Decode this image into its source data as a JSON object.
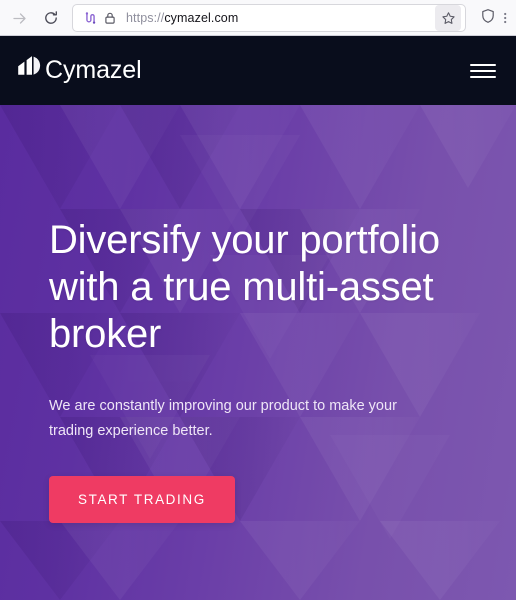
{
  "browser": {
    "forward_label": "forward-arrow",
    "reload_label": "reload",
    "extension_icon_label": "extension-icon",
    "lock_label": "connection-secure-lock",
    "url_scheme": "https://",
    "url_host": "cymazel.com",
    "url_full": "https://cymazel.com",
    "bookmark_label": "bookmark-star",
    "shield_label": "tracking-protection-shield"
  },
  "site": {
    "brand_name": "Cymazel",
    "menu_label": "menu",
    "hero": {
      "title": "Diversify your portfolio with a true multi-asset broker",
      "subtitle": "We are constantly improving our product to make your trading experience better.",
      "cta_label": "START TRADING"
    }
  },
  "colors": {
    "nav_bg": "#090d1c",
    "hero_gradient_start": "#5a2c9f",
    "hero_gradient_end": "#7d58b0",
    "cta_bg": "#ef3b63",
    "cta_text": "#ffffff",
    "toolbar_bg": "#f9f9fb",
    "extension_icon": "#8a63d2"
  }
}
